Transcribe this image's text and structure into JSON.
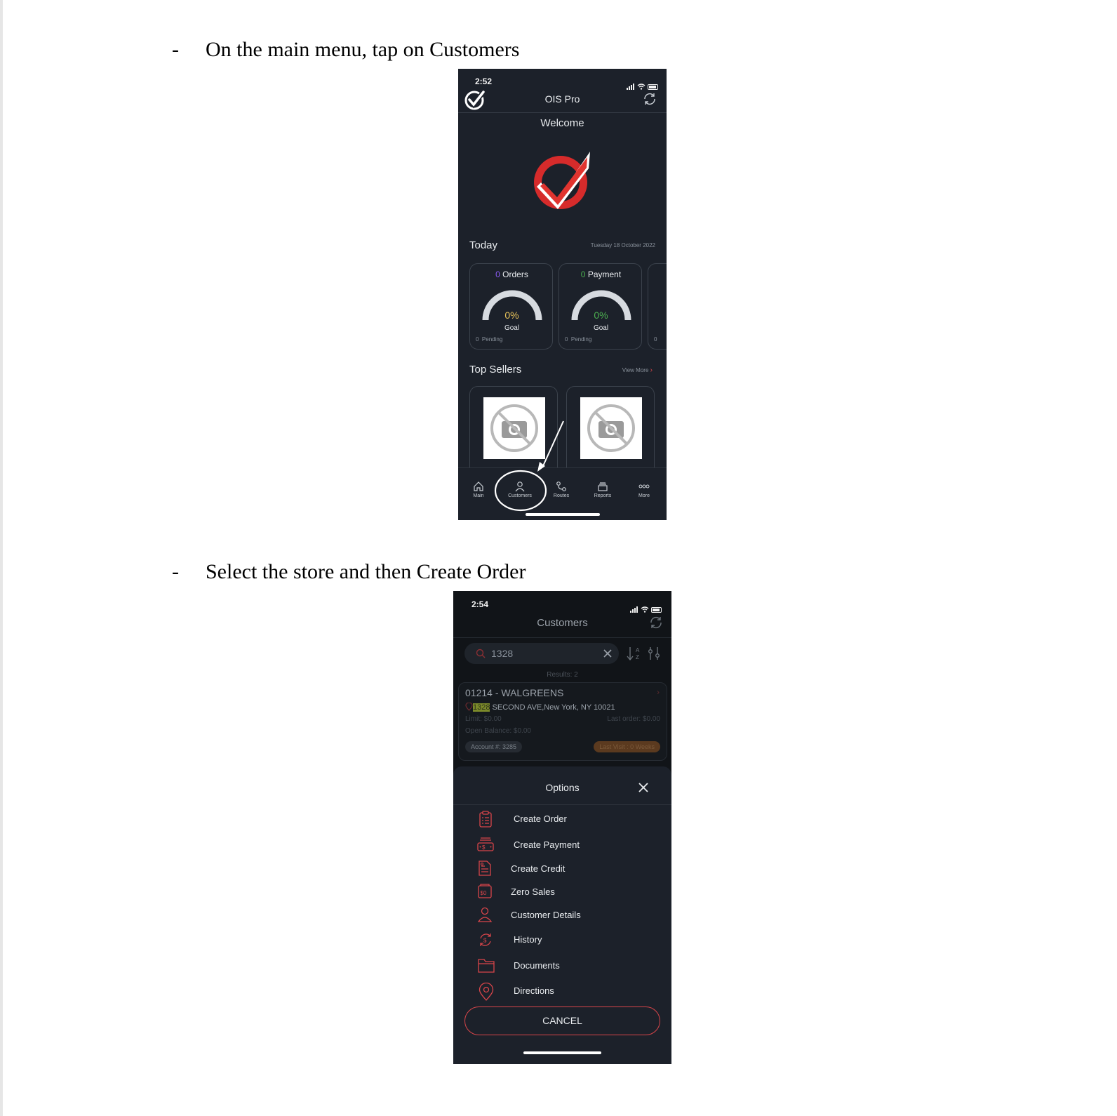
{
  "steps": [
    {
      "bullet": "-",
      "text": "On the main menu, tap on Customers"
    },
    {
      "bullet": "-",
      "text": "Select the store and then Create Order"
    }
  ],
  "phone1": {
    "time": "2:52",
    "app_title": "OIS Pro",
    "welcome": "Welcome",
    "today_label": "Today",
    "date": "Tuesday 18 October 2022",
    "cards": [
      {
        "count": "0",
        "title": "Orders",
        "percent": "0%",
        "goal": "Goal",
        "pending_count": "0",
        "pending_label": "Pending",
        "count_color": "#8b5cf6",
        "percent_color": "#e8c35a"
      },
      {
        "count": "0",
        "title": "Payment",
        "percent": "0%",
        "goal": "Goal",
        "pending_count": "0",
        "pending_label": "Pending",
        "count_color": "#4caf50",
        "percent_color": "#4caf50"
      }
    ],
    "partial_card_pending_count": "0",
    "top_sellers_label": "Top Sellers",
    "view_more": "View More",
    "tabs": [
      {
        "label": "Main",
        "icon": "home-icon"
      },
      {
        "label": "Customers",
        "icon": "person-icon"
      },
      {
        "label": "Routes",
        "icon": "route-icon"
      },
      {
        "label": "Reports",
        "icon": "stack-icon"
      },
      {
        "label": "More",
        "icon": "more-icon"
      }
    ],
    "highlight_color": "#ffffff"
  },
  "phone2": {
    "time": "2:54",
    "title": "Customers",
    "search_value": "1328",
    "results_label": "Results: 2",
    "customer": {
      "name": "01214 - WALGREENS",
      "address_highlight": "1328",
      "address_rest": " SECOND AVE,New York, NY 10021",
      "limit": "Limit: $0.00",
      "last_order": "Last order: $0.00",
      "open_balance": "Open Balance: $0.00",
      "account": "Account #: 3285",
      "last_visit": "Last Visit : 0 Weeks"
    },
    "options_title": "Options",
    "options": [
      {
        "label": "Create Order",
        "icon": "clipboard-list-icon"
      },
      {
        "label": "Create Payment",
        "icon": "cash-register-icon"
      },
      {
        "label": "Create Credit",
        "icon": "credit-document-icon"
      },
      {
        "label": "Zero Sales",
        "icon": "zero-dollar-icon"
      },
      {
        "label": "Customer Details",
        "icon": "person-outline-icon"
      },
      {
        "label": "History",
        "icon": "dollar-cycle-icon"
      },
      {
        "label": "Documents",
        "icon": "folder-icon"
      },
      {
        "label": "Directions",
        "icon": "map-pin-icon"
      }
    ],
    "cancel_label": "CANCEL",
    "accent_color": "#d9454a"
  }
}
